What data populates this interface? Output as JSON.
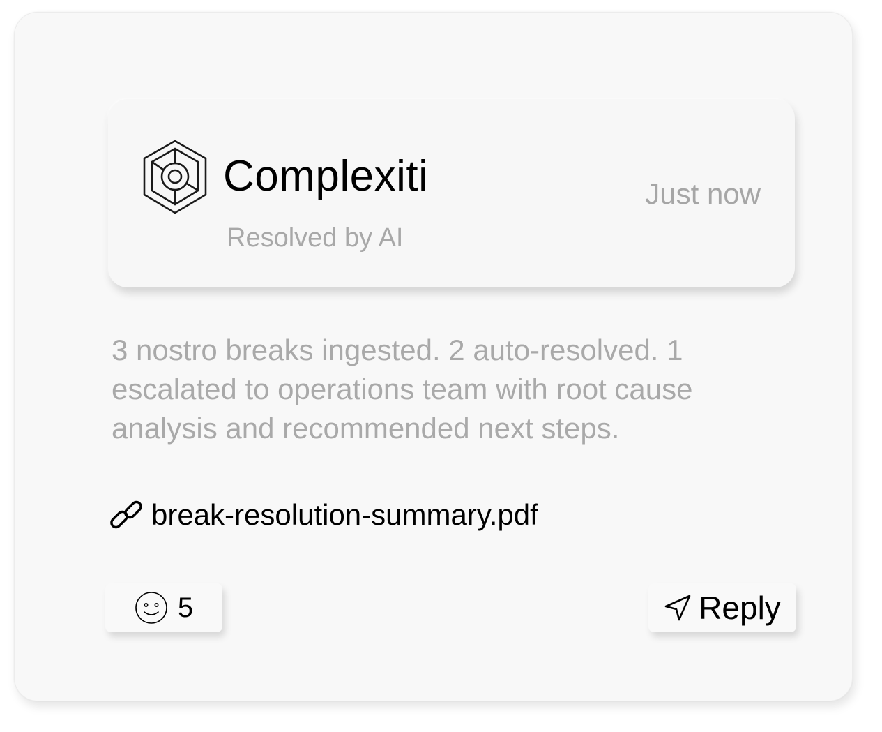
{
  "header": {
    "brand_name": "Complexiti",
    "subtitle": "Resolved by AI",
    "timestamp": "Just now",
    "logo_icon": "hexagon-target-logo-icon"
  },
  "message": {
    "text": "3 nostro breaks ingested. 2 auto-resolved. 1 escalated to operations team with root cause analysis and recommended next steps."
  },
  "attachment": {
    "icon": "link-icon",
    "file_name": "break-resolution-summary.pdf"
  },
  "actions": {
    "reaction_icon": "smile-icon",
    "reaction_count": "5",
    "reply_icon": "send-icon",
    "reply_label": "Reply"
  },
  "colors": {
    "card_background": "#f8f8f8",
    "muted_text": "#a8a8a8",
    "primary_text": "#000000"
  }
}
